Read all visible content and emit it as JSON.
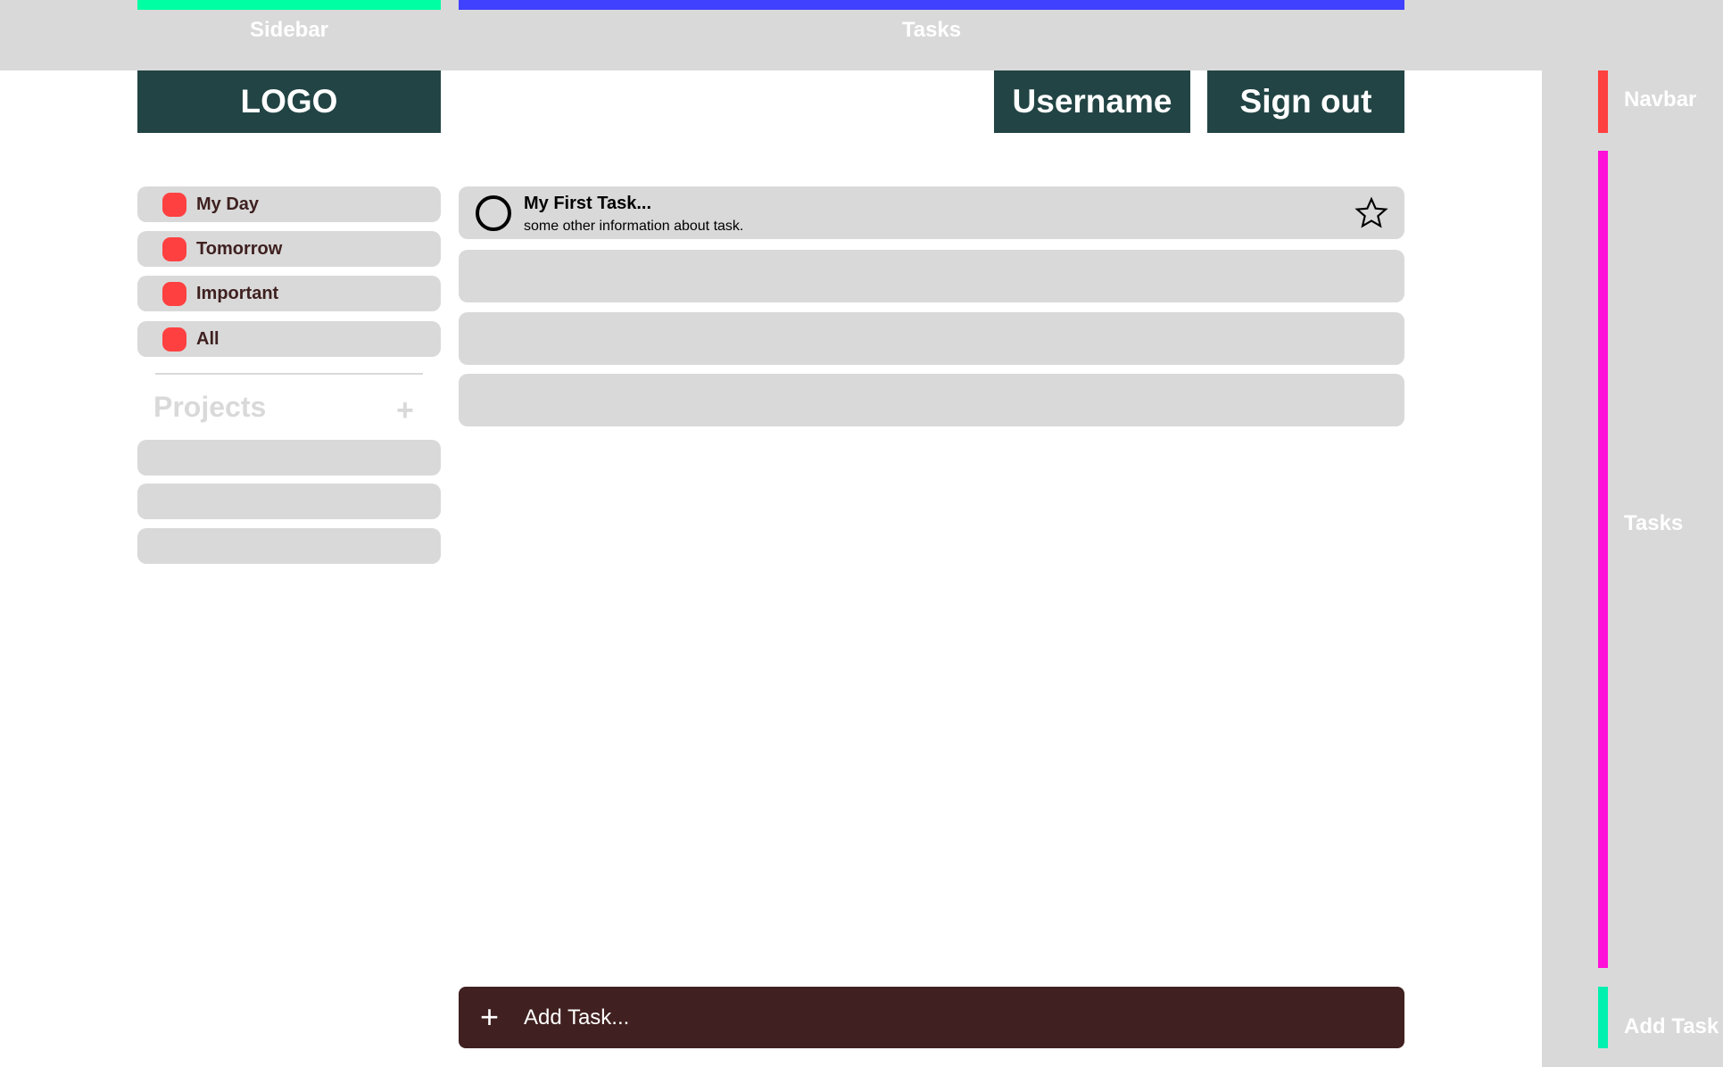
{
  "annotations": {
    "top": [
      {
        "label": "Sidebar",
        "color": "#00ffa3"
      },
      {
        "label": "Tasks",
        "color": "#4040ff"
      }
    ],
    "right": [
      {
        "label": "Navbar",
        "color": "#ff4040"
      },
      {
        "label": "Tasks",
        "color": "#ff10d8"
      },
      {
        "label": "Add Task",
        "color": "#00f0b0"
      }
    ]
  },
  "navbar": {
    "logo": "LOGO",
    "username": "Username",
    "signout": "Sign out"
  },
  "sidebar": {
    "items": [
      {
        "label": "My Day"
      },
      {
        "label": "Tomorrow"
      },
      {
        "label": "Important"
      },
      {
        "label": "All"
      }
    ],
    "dot_color": "#ff4040",
    "projects_title": "Projects",
    "add_project_icon": "plus-icon"
  },
  "tasks": {
    "items": [
      {
        "title": "My First Task...",
        "subtitle": "some other information about task.",
        "completed": false,
        "starred": false
      }
    ]
  },
  "add_task": {
    "placeholder": "Add Task...",
    "icon": "plus-icon",
    "bg": "#402020"
  }
}
